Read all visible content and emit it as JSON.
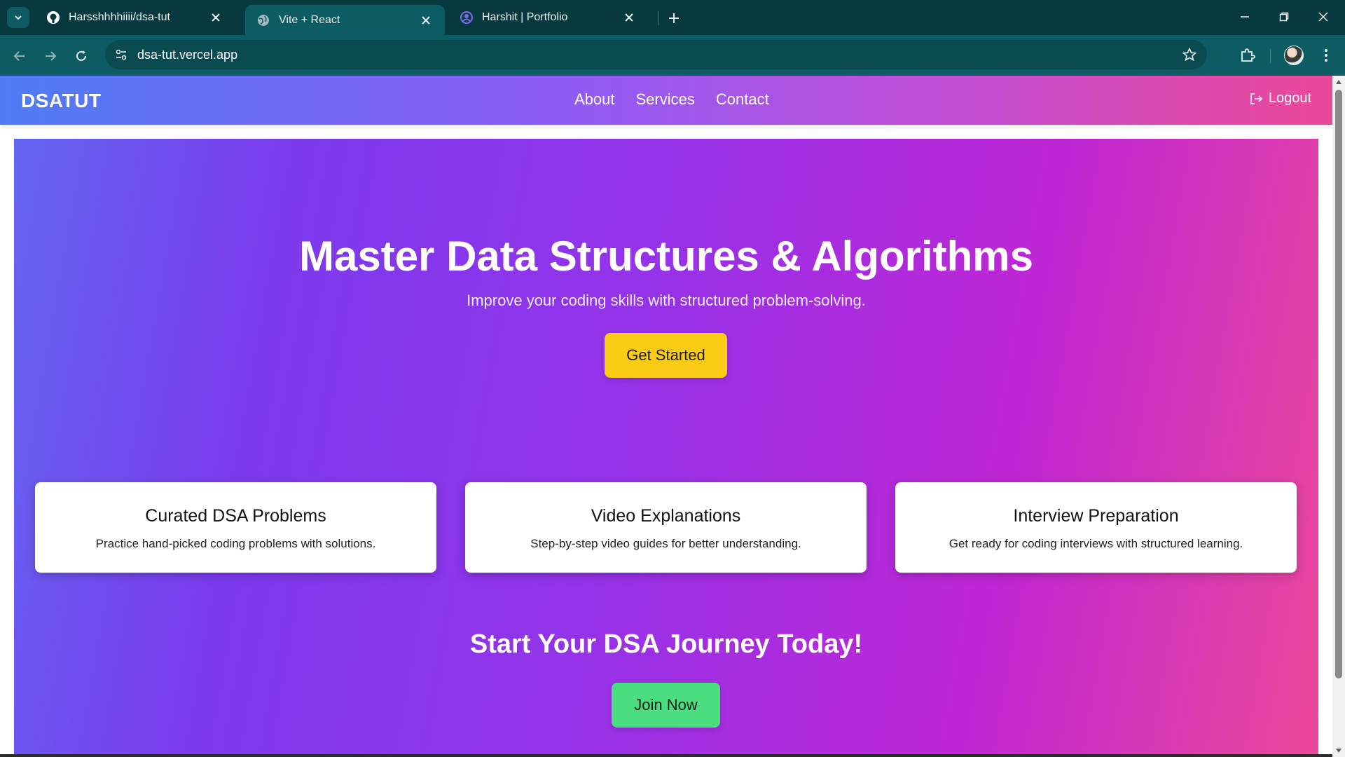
{
  "browser": {
    "tabs": [
      {
        "title": "Harsshhhhiiii/dsa-tut",
        "icon": "github-icon",
        "active": false
      },
      {
        "title": "Vite + React",
        "icon": "globe-icon",
        "active": true
      },
      {
        "title": "Harshit | Portfolio",
        "icon": "portfolio-icon",
        "active": false
      }
    ],
    "url": "dsa-tut.vercel.app"
  },
  "site": {
    "brand": "DSATUT",
    "nav": [
      "About",
      "Services",
      "Contact"
    ],
    "logout": "Logout",
    "hero": {
      "title": "Master Data Structures & Algorithms",
      "subtitle": "Improve your coding skills with structured problem-solving.",
      "cta": "Get Started"
    },
    "features": [
      {
        "title": "Curated DSA Problems",
        "desc": "Practice hand-picked coding problems with solutions."
      },
      {
        "title": "Video Explanations",
        "desc": "Step-by-step video guides for better understanding."
      },
      {
        "title": "Interview Preparation",
        "desc": "Get ready for coding interviews with structured learning."
      }
    ],
    "journey": {
      "title": "Start Your DSA Journey Today!",
      "button": "Join Now"
    }
  },
  "colors": {
    "chrome_dark": "#07393f",
    "chrome_toolbar": "#0d5c63",
    "hero_gradient": [
      "#6366f1",
      "#9333ea",
      "#ec4899"
    ],
    "start_button": "#facc15",
    "join_button": "#4ade80"
  }
}
